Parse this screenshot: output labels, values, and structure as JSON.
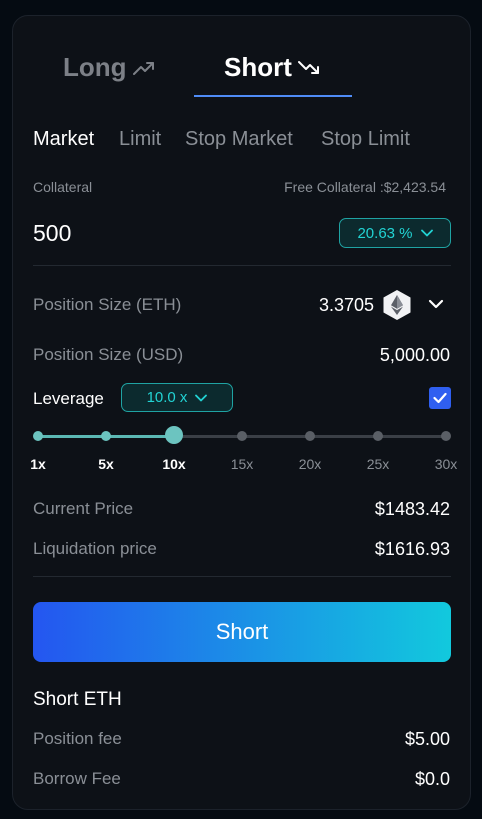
{
  "side_tabs": {
    "long": "Long",
    "short": "Short"
  },
  "order_types": [
    "Market",
    "Limit",
    "Stop Market",
    "Stop Limit"
  ],
  "collateral": {
    "label": "Collateral",
    "free_label": "Free Collateral :$2,423.54",
    "amount": "500",
    "percent": "20.63 %"
  },
  "position": {
    "size_eth_label": "Position Size (ETH)",
    "size_eth_value": "3.3705",
    "token_icon": "ethereum-icon",
    "size_usd_label": "Position Size (USD)",
    "size_usd_value": "5,000.00"
  },
  "leverage": {
    "label": "Leverage",
    "value": "10.0 x",
    "enabled": true,
    "ticks": [
      "1x",
      "5x",
      "10x",
      "15x",
      "20x",
      "25x",
      "30x"
    ],
    "selected_index": 2
  },
  "prices": {
    "current_label": "Current Price",
    "current_value": "$1483.42",
    "liq_label": "Liquidation price",
    "liq_value": "$1616.93"
  },
  "action_button": "Short",
  "summary": {
    "title": "Short ETH",
    "fee_label": "Position fee",
    "fee_value": "$5.00",
    "borrow_label": "Borrow Fee",
    "borrow_value": "$0.0"
  },
  "colors": {
    "accent_teal": "#22d3d3",
    "accent_blue": "#2f5ff0",
    "button_gradient_start": "#2456f0",
    "button_gradient_end": "#12c9dd"
  }
}
